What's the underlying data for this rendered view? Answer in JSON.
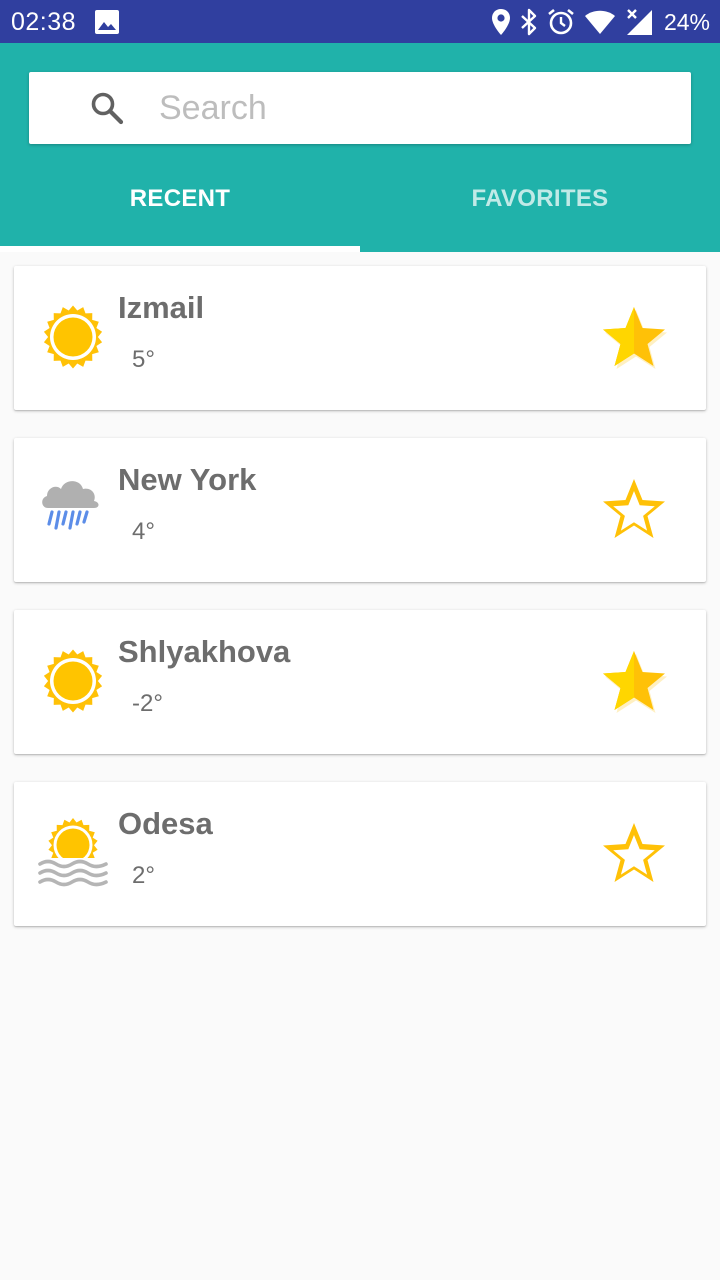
{
  "status_bar": {
    "time": "02:38",
    "battery": "24%",
    "icons": [
      "gallery-icon",
      "location-icon",
      "bluetooth-icon",
      "alarm-icon",
      "wifi-icon",
      "signal-icon"
    ]
  },
  "search": {
    "placeholder": "Search",
    "value": ""
  },
  "tabs": [
    {
      "label": "RECENT",
      "selected": true
    },
    {
      "label": "FAVORITES",
      "selected": false
    }
  ],
  "colors": {
    "status_bar": "#303f9f",
    "accent": "#20b2aa",
    "star": "#ffc107",
    "text": "#6d6d6d"
  },
  "cities": [
    {
      "name": "Izmail",
      "temp": "5°",
      "weather_icon": "sun-icon",
      "favorite": true
    },
    {
      "name": "New York",
      "temp": "4°",
      "weather_icon": "rain-cloud-icon",
      "favorite": false
    },
    {
      "name": "Shlyakhova",
      "temp": "-2°",
      "weather_icon": "sun-icon",
      "favorite": true
    },
    {
      "name": "Odesa",
      "temp": "2°",
      "weather_icon": "sun-haze-icon",
      "favorite": false
    }
  ]
}
